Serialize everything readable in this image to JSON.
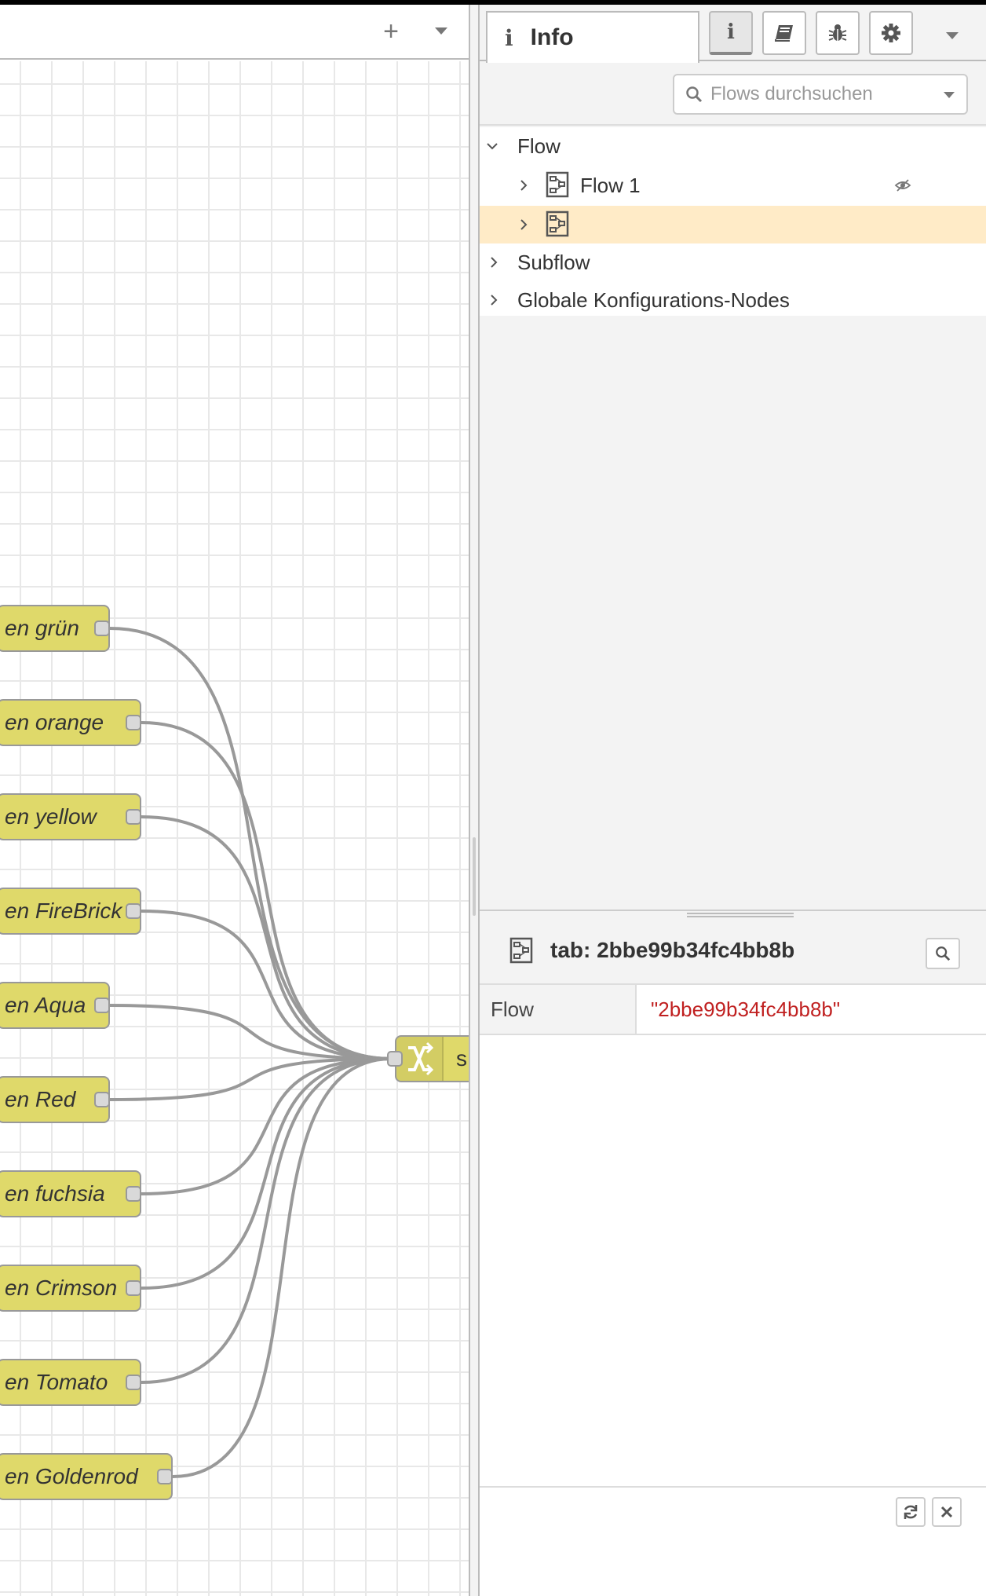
{
  "workspace": {
    "add_tab_label": "+",
    "nodes": [
      {
        "label": "en grün"
      },
      {
        "label": "en orange"
      },
      {
        "label": "en yellow"
      },
      {
        "label": "en FireBrick"
      },
      {
        "label": "en Aqua"
      },
      {
        "label": "en Red"
      },
      {
        "label": "en fuchsia"
      },
      {
        "label": "en Crimson"
      },
      {
        "label": "en Tomato"
      },
      {
        "label": "en Goldenrod"
      }
    ],
    "switch_node": {
      "label": "s",
      "icon": "switch-icon"
    },
    "colors": {
      "node_fill": "#dfd96a",
      "wire": "#999999"
    }
  },
  "sidebar": {
    "tab_info_label": "Info",
    "tab_icons": [
      "info-icon",
      "book-icon",
      "bug-icon",
      "gear-icon"
    ],
    "search_placeholder": "Flows durchsuchen",
    "tree": {
      "flow_section": "Flow",
      "flow_1": "Flow 1",
      "flow_2": "",
      "subflow_section": "Subflow",
      "global_config": "Globale Konfigurations-Nodes"
    },
    "info": {
      "title": "tab: 2bbe99b34fc4bb8b",
      "prop_key": "Flow",
      "prop_value": "\"2bbe99b34fc4bb8b\""
    },
    "colors": {
      "selected_row": "#ffebc7",
      "value_text": "#c02020"
    }
  }
}
